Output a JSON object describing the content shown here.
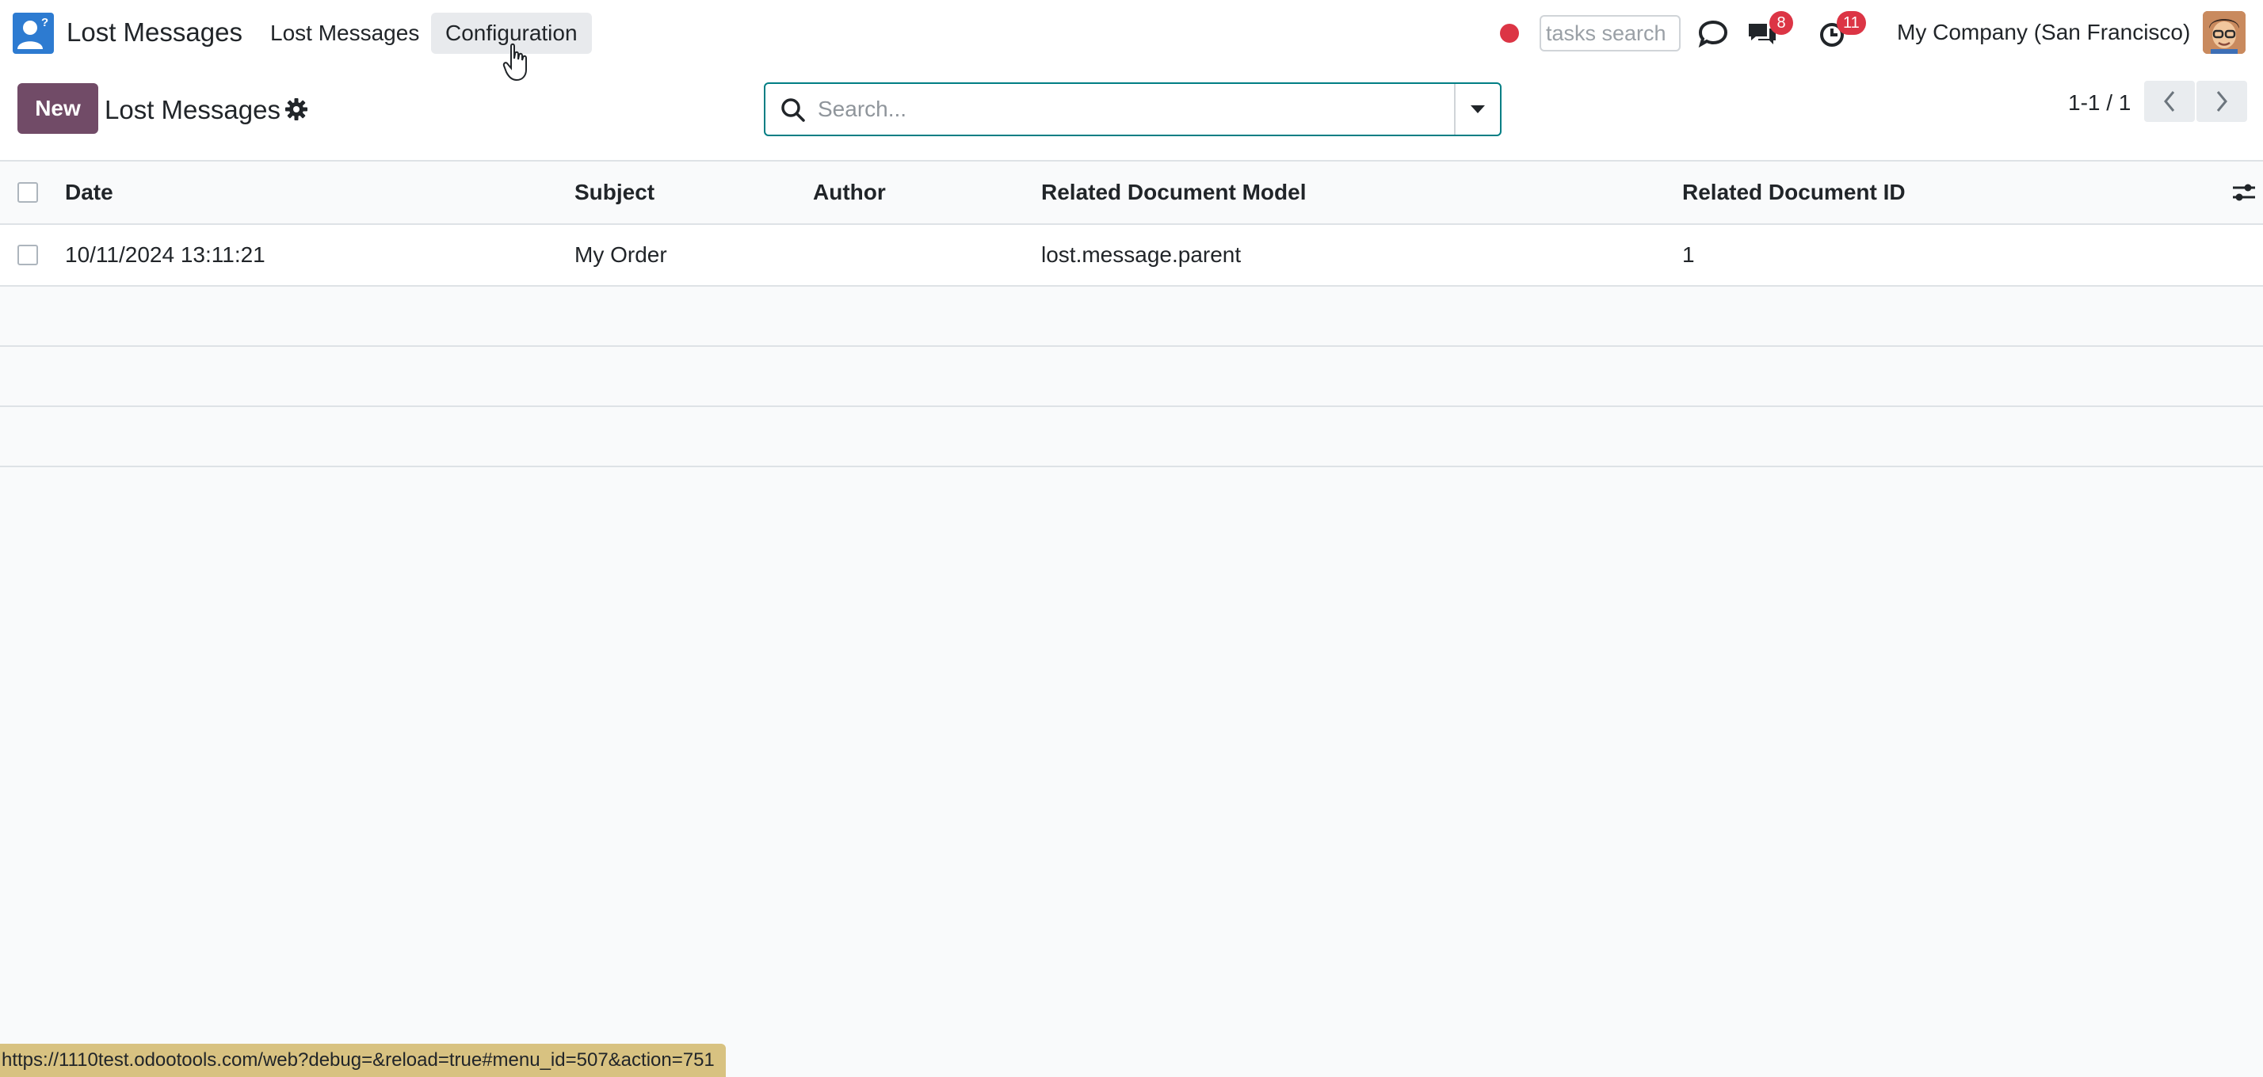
{
  "navbar": {
    "app_name": "Lost Messages",
    "menu": [
      {
        "label": "Lost Messages"
      },
      {
        "label": "Configuration"
      }
    ],
    "tasks_search_placeholder": "tasks search",
    "messages_badge": "8",
    "activities_badge": "11",
    "company": "My Company (San Francisco)",
    "colors": {
      "record": "#dc3545",
      "badge": "#dc3545",
      "app_icon": "#2d7bd1"
    }
  },
  "control_panel": {
    "new_label": "New",
    "title": "Lost Messages",
    "search_placeholder": "Search...",
    "pager": "1-1 / 1",
    "colors": {
      "primary": "#714b67",
      "search_border": "#017e84"
    }
  },
  "list": {
    "columns": [
      "Date",
      "Subject",
      "Author",
      "Related Document Model",
      "Related Document ID"
    ],
    "rows": [
      {
        "date": "10/11/2024 13:11:21",
        "subject": "My Order",
        "author": "",
        "model": "lost.message.parent",
        "doc_id": "1"
      }
    ]
  },
  "statusbar": {
    "url": "https://1110test.odootools.com/web?debug=&reload=true#menu_id=507&action=751"
  }
}
